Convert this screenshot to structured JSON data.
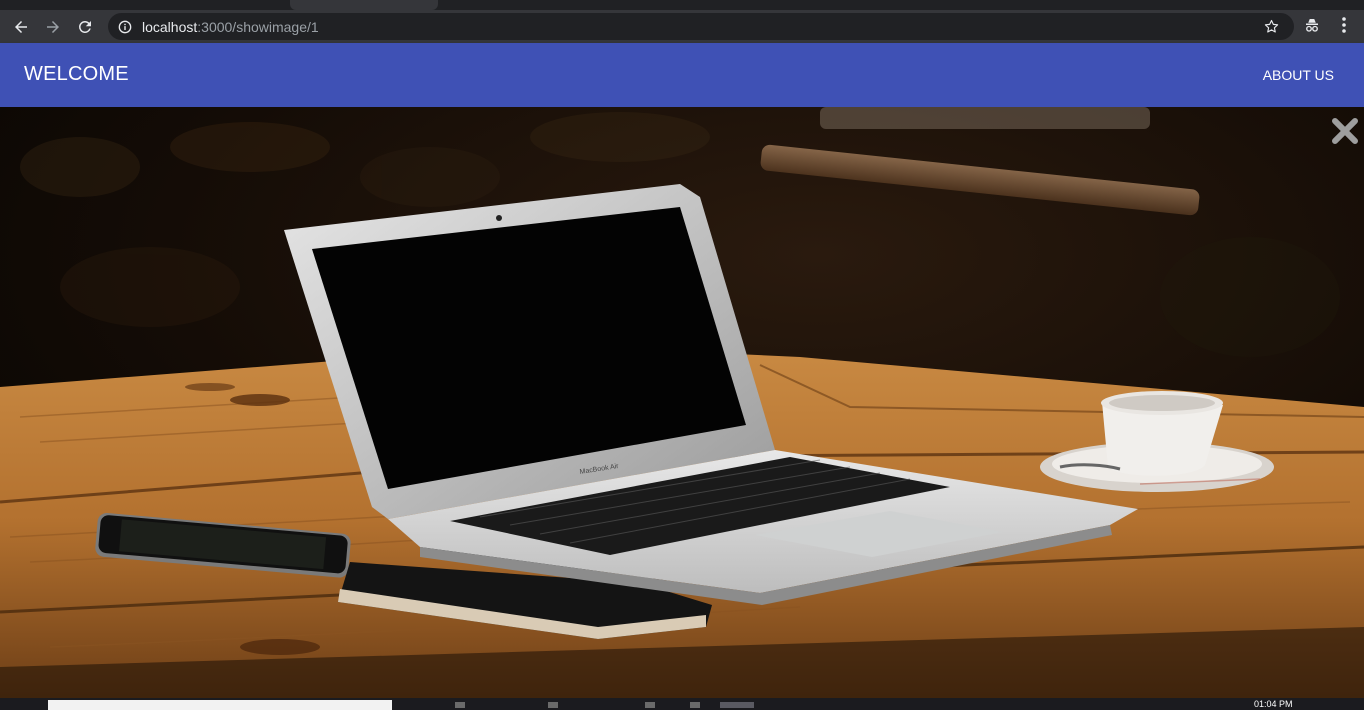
{
  "browser": {
    "url_host": "localhost",
    "url_path": ":3000/showimage/1"
  },
  "appbar": {
    "title": "WELCOME",
    "nav_about": "ABOUT US",
    "color": "#3f51b5"
  },
  "viewer": {
    "close_icon": "close-icon",
    "laptop_brand_text": "MacBook Air"
  },
  "taskbar": {
    "clock": "01:04 PM"
  }
}
